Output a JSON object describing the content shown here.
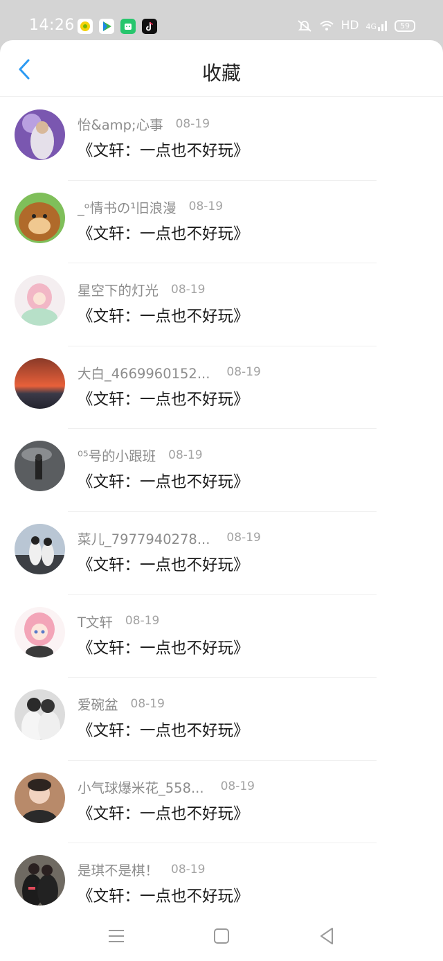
{
  "status_bar": {
    "time": "14:26",
    "hd_label": "HD",
    "network": "4G",
    "battery": "59",
    "app_icons": [
      "lemon-app-icon",
      "video-player-icon",
      "android-store-icon",
      "tiktok-icon"
    ]
  },
  "header": {
    "title": "收藏",
    "back_icon": "chevron-left-icon",
    "accent_color": "#2b9af3"
  },
  "favorites": [
    {
      "user": "怡&amp;心事",
      "date": "08-19",
      "title": "《文轩：一点也不好玩》"
    },
    {
      "user": "_ᵒ情书の¹旧浪漫",
      "date": "08-19",
      "title": "《文轩：一点也不好玩》"
    },
    {
      "user": "星空下的灯光",
      "date": "08-19",
      "title": "《文轩：一点也不好玩》"
    },
    {
      "user": "大白_4669960152...",
      "date": "08-19",
      "title": "《文轩：一点也不好玩》"
    },
    {
      "user": "⁰⁵号的小跟班",
      "date": "08-19",
      "title": "《文轩：一点也不好玩》"
    },
    {
      "user": "菜儿_7977940278...",
      "date": "08-19",
      "title": "《文轩：一点也不好玩》"
    },
    {
      "user": "T文轩",
      "date": "08-19",
      "title": "《文轩：一点也不好玩》"
    },
    {
      "user": "爱碗盆",
      "date": "08-19",
      "title": "《文轩：一点也不好玩》"
    },
    {
      "user": "小气球爆米花_558...",
      "date": "08-19",
      "title": "《文轩：一点也不好玩》"
    },
    {
      "user": "是琪不是棋！",
      "date": "08-19",
      "title": "《文轩：一点也不好玩》"
    }
  ],
  "nav_bar": {
    "icons": [
      "menu-icon",
      "home-square-icon",
      "back-triangle-icon"
    ]
  }
}
